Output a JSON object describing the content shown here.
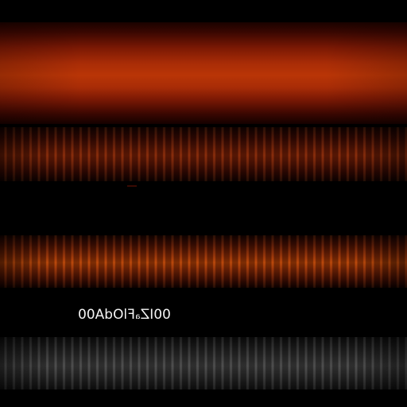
{
  "caption": {
    "text": "00IZₐFlOdA00"
  },
  "colors": {
    "background": "#000000",
    "band_1_peak": "#b93506",
    "band_2_peak": "#7a2006",
    "band_3_peak": "#b24006",
    "band_4_peak": "#404040",
    "caption": "#f4f4f4"
  }
}
